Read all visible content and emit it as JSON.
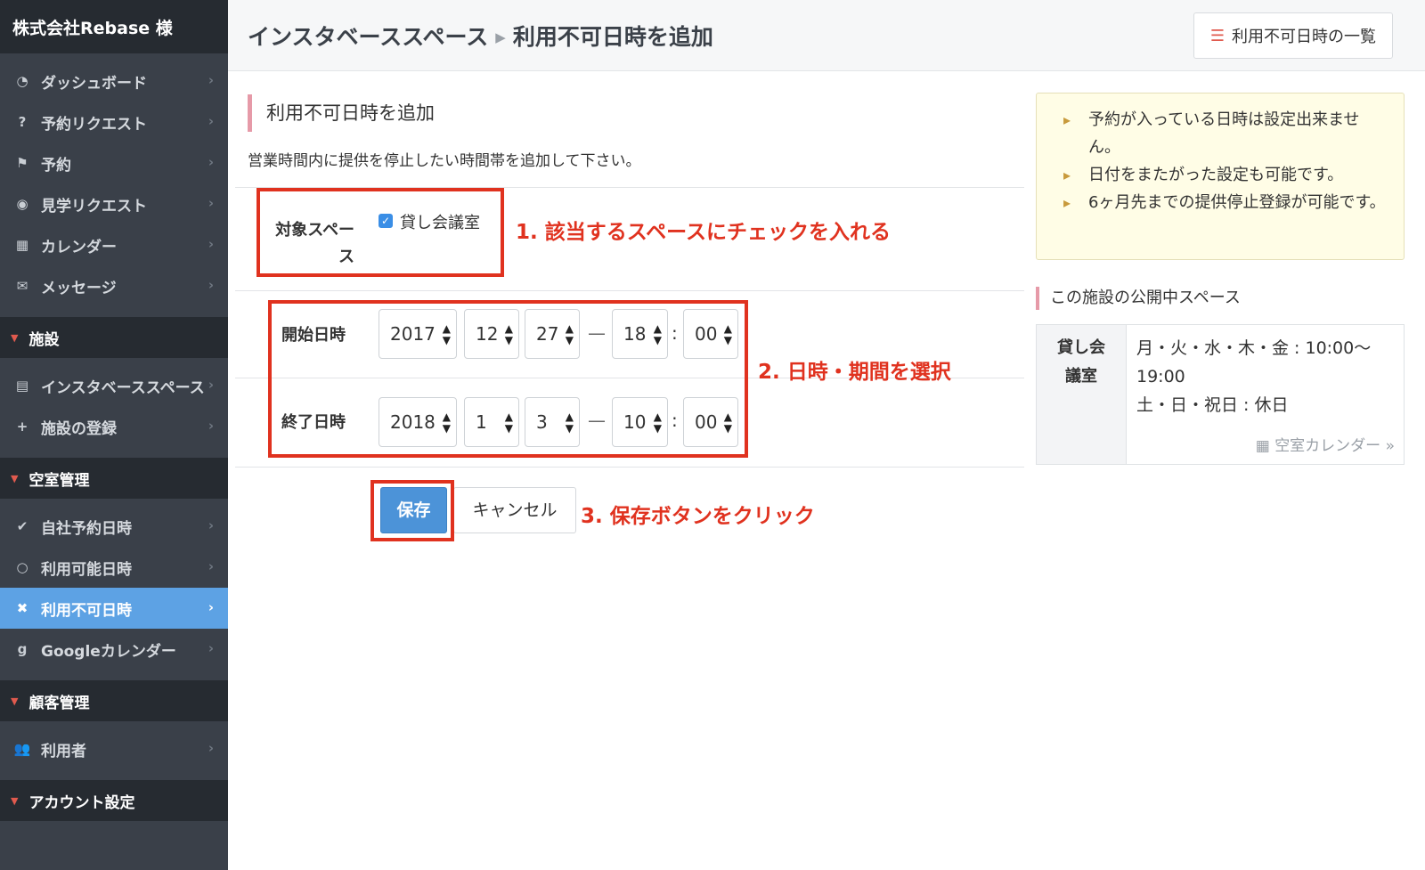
{
  "sidebar": {
    "brand": "株式会社Rebase 様",
    "items_main": [
      {
        "label": "ダッシュボード",
        "icon": "dashboard-icon"
      },
      {
        "label": "予約リクエスト",
        "icon": "question-icon"
      },
      {
        "label": "予約",
        "icon": "flag-icon"
      },
      {
        "label": "見学リクエスト",
        "icon": "eye-icon"
      },
      {
        "label": "カレンダー",
        "icon": "calendar-icon"
      },
      {
        "label": "メッセージ",
        "icon": "envelope-icon"
      }
    ],
    "section_facility": "施設",
    "items_facility": [
      {
        "label": "インスタベーススペース",
        "icon": "building-icon"
      },
      {
        "label": "施設の登録",
        "icon": "plus-icon"
      }
    ],
    "section_vacancy": "空室管理",
    "items_vacancy": [
      {
        "label": "自社予約日時",
        "icon": "check-icon"
      },
      {
        "label": "利用可能日時",
        "icon": "circle-icon"
      },
      {
        "label": "利用不可日時",
        "icon": "times-icon",
        "active": true
      },
      {
        "label": "Googleカレンダー",
        "icon": "google-icon"
      }
    ],
    "section_customer": "顧客管理",
    "items_customer": [
      {
        "label": "利用者",
        "icon": "users-icon"
      }
    ],
    "section_account": "アカウント設定"
  },
  "header": {
    "crumb_parent": "インスタベーススペース",
    "crumb_current": "利用不可日時を追加",
    "list_button": "利用不可日時の一覧"
  },
  "form": {
    "title": "利用不可日時を追加",
    "description": "営業時間内に提供を停止したい時間帯を追加して下さい。",
    "target_label": "対象スペース",
    "space_option": "貸し会議室",
    "space_checked": true,
    "start_label": "開始日時",
    "start": {
      "year": "2017",
      "month": "12",
      "day": "27",
      "hour": "18",
      "minute": "00"
    },
    "end_label": "終了日時",
    "end": {
      "year": "2018",
      "month": "1",
      "day": "3",
      "hour": "10",
      "minute": "00"
    },
    "dash": "—",
    "colon": ":",
    "save": "保存",
    "cancel": "キャンセル"
  },
  "annotations": {
    "step1": "1. 該当するスペースにチェックを入れる",
    "step2": "2. 日時・期間を選択",
    "step3": "3. 保存ボタンをクリック",
    "color": "#e0321f"
  },
  "notice": {
    "items": [
      "予約が入っている日時は設定出来ません。",
      "日付をまたがった設定も可能です。",
      "6ヶ月先までの提供停止登録が可能です。"
    ]
  },
  "public_spaces": {
    "title": "この施設の公開中スペース",
    "space_name": "貸し会議室",
    "hours_line1": "月・火・水・木・金 : 10:00〜19:00",
    "hours_line2": "土・日・祝日 : 休日",
    "calendar_link": "空室カレンダー »"
  },
  "colors": {
    "sidebar_bg": "#3a4049",
    "active_item": "#5da2e4",
    "primary_button": "#4c93d8",
    "accent_pink": "#e69aa8"
  }
}
